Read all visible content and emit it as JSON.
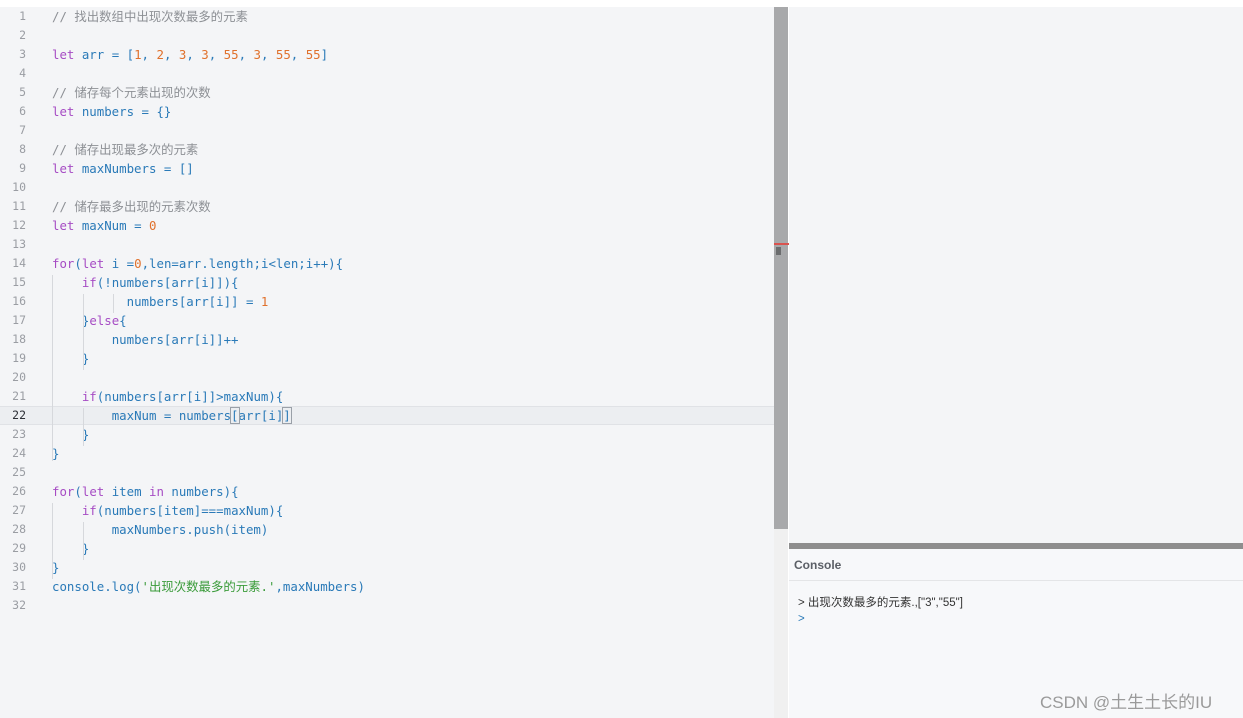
{
  "editor": {
    "active_line": 22,
    "lines": [
      {
        "n": "1",
        "tokens": [
          [
            "c-comment",
            "// 找出数组中出现次数最多的元素"
          ]
        ]
      },
      {
        "n": "2",
        "tokens": []
      },
      {
        "n": "3",
        "tokens": [
          [
            "c-kw",
            "let "
          ],
          [
            "c-var",
            "arr "
          ],
          [
            "c-op",
            "= ["
          ],
          [
            "c-num",
            "1"
          ],
          [
            "c-op",
            ", "
          ],
          [
            "c-num",
            "2"
          ],
          [
            "c-op",
            ", "
          ],
          [
            "c-num",
            "3"
          ],
          [
            "c-op",
            ", "
          ],
          [
            "c-num",
            "3"
          ],
          [
            "c-op",
            ", "
          ],
          [
            "c-num",
            "55"
          ],
          [
            "c-op",
            ", "
          ],
          [
            "c-num",
            "3"
          ],
          [
            "c-op",
            ", "
          ],
          [
            "c-num",
            "55"
          ],
          [
            "c-op",
            ", "
          ],
          [
            "c-num",
            "55"
          ],
          [
            "c-op",
            "]"
          ]
        ]
      },
      {
        "n": "4",
        "tokens": []
      },
      {
        "n": "5",
        "tokens": [
          [
            "c-comment",
            "// 储存每个元素出现的次数"
          ]
        ]
      },
      {
        "n": "6",
        "tokens": [
          [
            "c-kw",
            "let "
          ],
          [
            "c-var",
            "numbers "
          ],
          [
            "c-op",
            "= {}"
          ]
        ]
      },
      {
        "n": "7",
        "tokens": []
      },
      {
        "n": "8",
        "tokens": [
          [
            "c-comment",
            "// 储存出现最多次的元素"
          ]
        ]
      },
      {
        "n": "9",
        "tokens": [
          [
            "c-kw",
            "let "
          ],
          [
            "c-var",
            "maxNumbers "
          ],
          [
            "c-op",
            "= []"
          ]
        ]
      },
      {
        "n": "10",
        "tokens": []
      },
      {
        "n": "11",
        "tokens": [
          [
            "c-comment",
            "// 储存最多出现的元素次数"
          ]
        ]
      },
      {
        "n": "12",
        "tokens": [
          [
            "c-kw",
            "let "
          ],
          [
            "c-var",
            "maxNum "
          ],
          [
            "c-op",
            "= "
          ],
          [
            "c-num",
            "0"
          ]
        ]
      },
      {
        "n": "13",
        "tokens": []
      },
      {
        "n": "14",
        "tokens": [
          [
            "c-kw",
            "for"
          ],
          [
            "c-op",
            "("
          ],
          [
            "c-kw",
            "let "
          ],
          [
            "c-var",
            "i "
          ],
          [
            "c-op",
            "="
          ],
          [
            "c-num",
            "0"
          ],
          [
            "c-op",
            ","
          ],
          [
            "c-var",
            "len"
          ],
          [
            "c-op",
            "="
          ],
          [
            "c-var",
            "arr.length"
          ],
          [
            "c-op",
            ";"
          ],
          [
            "c-var",
            "i"
          ],
          [
            "c-op",
            "<"
          ],
          [
            "c-var",
            "len"
          ],
          [
            "c-op",
            ";"
          ],
          [
            "c-var",
            "i"
          ],
          [
            "c-op",
            "++){"
          ]
        ]
      },
      {
        "n": "15",
        "tokens": [
          [
            "c-op",
            "    "
          ],
          [
            "c-kw",
            "if"
          ],
          [
            "c-op",
            "(!"
          ],
          [
            "c-var",
            "numbers[arr[i]]"
          ],
          [
            "c-op",
            "){"
          ]
        ]
      },
      {
        "n": "16",
        "tokens": [
          [
            "c-op",
            "          "
          ],
          [
            "c-var",
            "numbers[arr[i]] "
          ],
          [
            "c-op",
            "= "
          ],
          [
            "c-num",
            "1"
          ]
        ]
      },
      {
        "n": "17",
        "tokens": [
          [
            "c-op",
            "    }"
          ],
          [
            "c-kw",
            "else"
          ],
          [
            "c-op",
            "{"
          ]
        ]
      },
      {
        "n": "18",
        "tokens": [
          [
            "c-op",
            "        "
          ],
          [
            "c-var",
            "numbers[arr[i]]"
          ],
          [
            "c-op",
            "++"
          ]
        ]
      },
      {
        "n": "19",
        "tokens": [
          [
            "c-op",
            "    }"
          ]
        ]
      },
      {
        "n": "20",
        "tokens": []
      },
      {
        "n": "21",
        "tokens": [
          [
            "c-op",
            "    "
          ],
          [
            "c-kw",
            "if"
          ],
          [
            "c-op",
            "("
          ],
          [
            "c-var",
            "numbers[arr[i]]"
          ],
          [
            "c-op",
            ">"
          ],
          [
            "c-var",
            "maxNum"
          ],
          [
            "c-op",
            "){"
          ]
        ]
      },
      {
        "n": "22",
        "tokens": [
          [
            "c-op",
            "        "
          ],
          [
            "c-var",
            "maxNum "
          ],
          [
            "c-op",
            "= "
          ],
          [
            "c-var",
            "numbers"
          ],
          [
            "bracket-match",
            "["
          ],
          [
            "c-var",
            "arr[i]"
          ],
          [
            "bracket-match",
            "]"
          ]
        ]
      },
      {
        "n": "23",
        "tokens": [
          [
            "c-op",
            "    }"
          ]
        ]
      },
      {
        "n": "24",
        "tokens": [
          [
            "c-op",
            "}"
          ]
        ]
      },
      {
        "n": "25",
        "tokens": []
      },
      {
        "n": "26",
        "tokens": [
          [
            "c-kw",
            "for"
          ],
          [
            "c-op",
            "("
          ],
          [
            "c-kw",
            "let "
          ],
          [
            "c-var",
            "item "
          ],
          [
            "c-kw",
            "in "
          ],
          [
            "c-var",
            "numbers"
          ],
          [
            "c-op",
            "){"
          ]
        ]
      },
      {
        "n": "27",
        "tokens": [
          [
            "c-op",
            "    "
          ],
          [
            "c-kw",
            "if"
          ],
          [
            "c-op",
            "("
          ],
          [
            "c-var",
            "numbers[item]"
          ],
          [
            "c-op",
            "==="
          ],
          [
            "c-var",
            "maxNum"
          ],
          [
            "c-op",
            "){"
          ]
        ]
      },
      {
        "n": "28",
        "tokens": [
          [
            "c-op",
            "        "
          ],
          [
            "c-var",
            "maxNumbers.push(item)"
          ]
        ]
      },
      {
        "n": "29",
        "tokens": [
          [
            "c-op",
            "    }"
          ]
        ]
      },
      {
        "n": "30",
        "tokens": [
          [
            "c-op",
            "}"
          ]
        ]
      },
      {
        "n": "31",
        "tokens": [
          [
            "c-var",
            "console.log("
          ],
          [
            "c-str",
            "'出现次数最多的元素.'"
          ],
          [
            "c-op",
            ","
          ],
          [
            "c-var",
            "maxNumbers"
          ],
          [
            "c-op",
            ")"
          ]
        ]
      },
      {
        "n": "32",
        "tokens": []
      }
    ]
  },
  "console": {
    "title": "Console",
    "output": "> 出现次数最多的元素.,[\"3\",\"55\"]",
    "prompt": ">"
  },
  "watermark": "CSDN @土生土长的IU"
}
